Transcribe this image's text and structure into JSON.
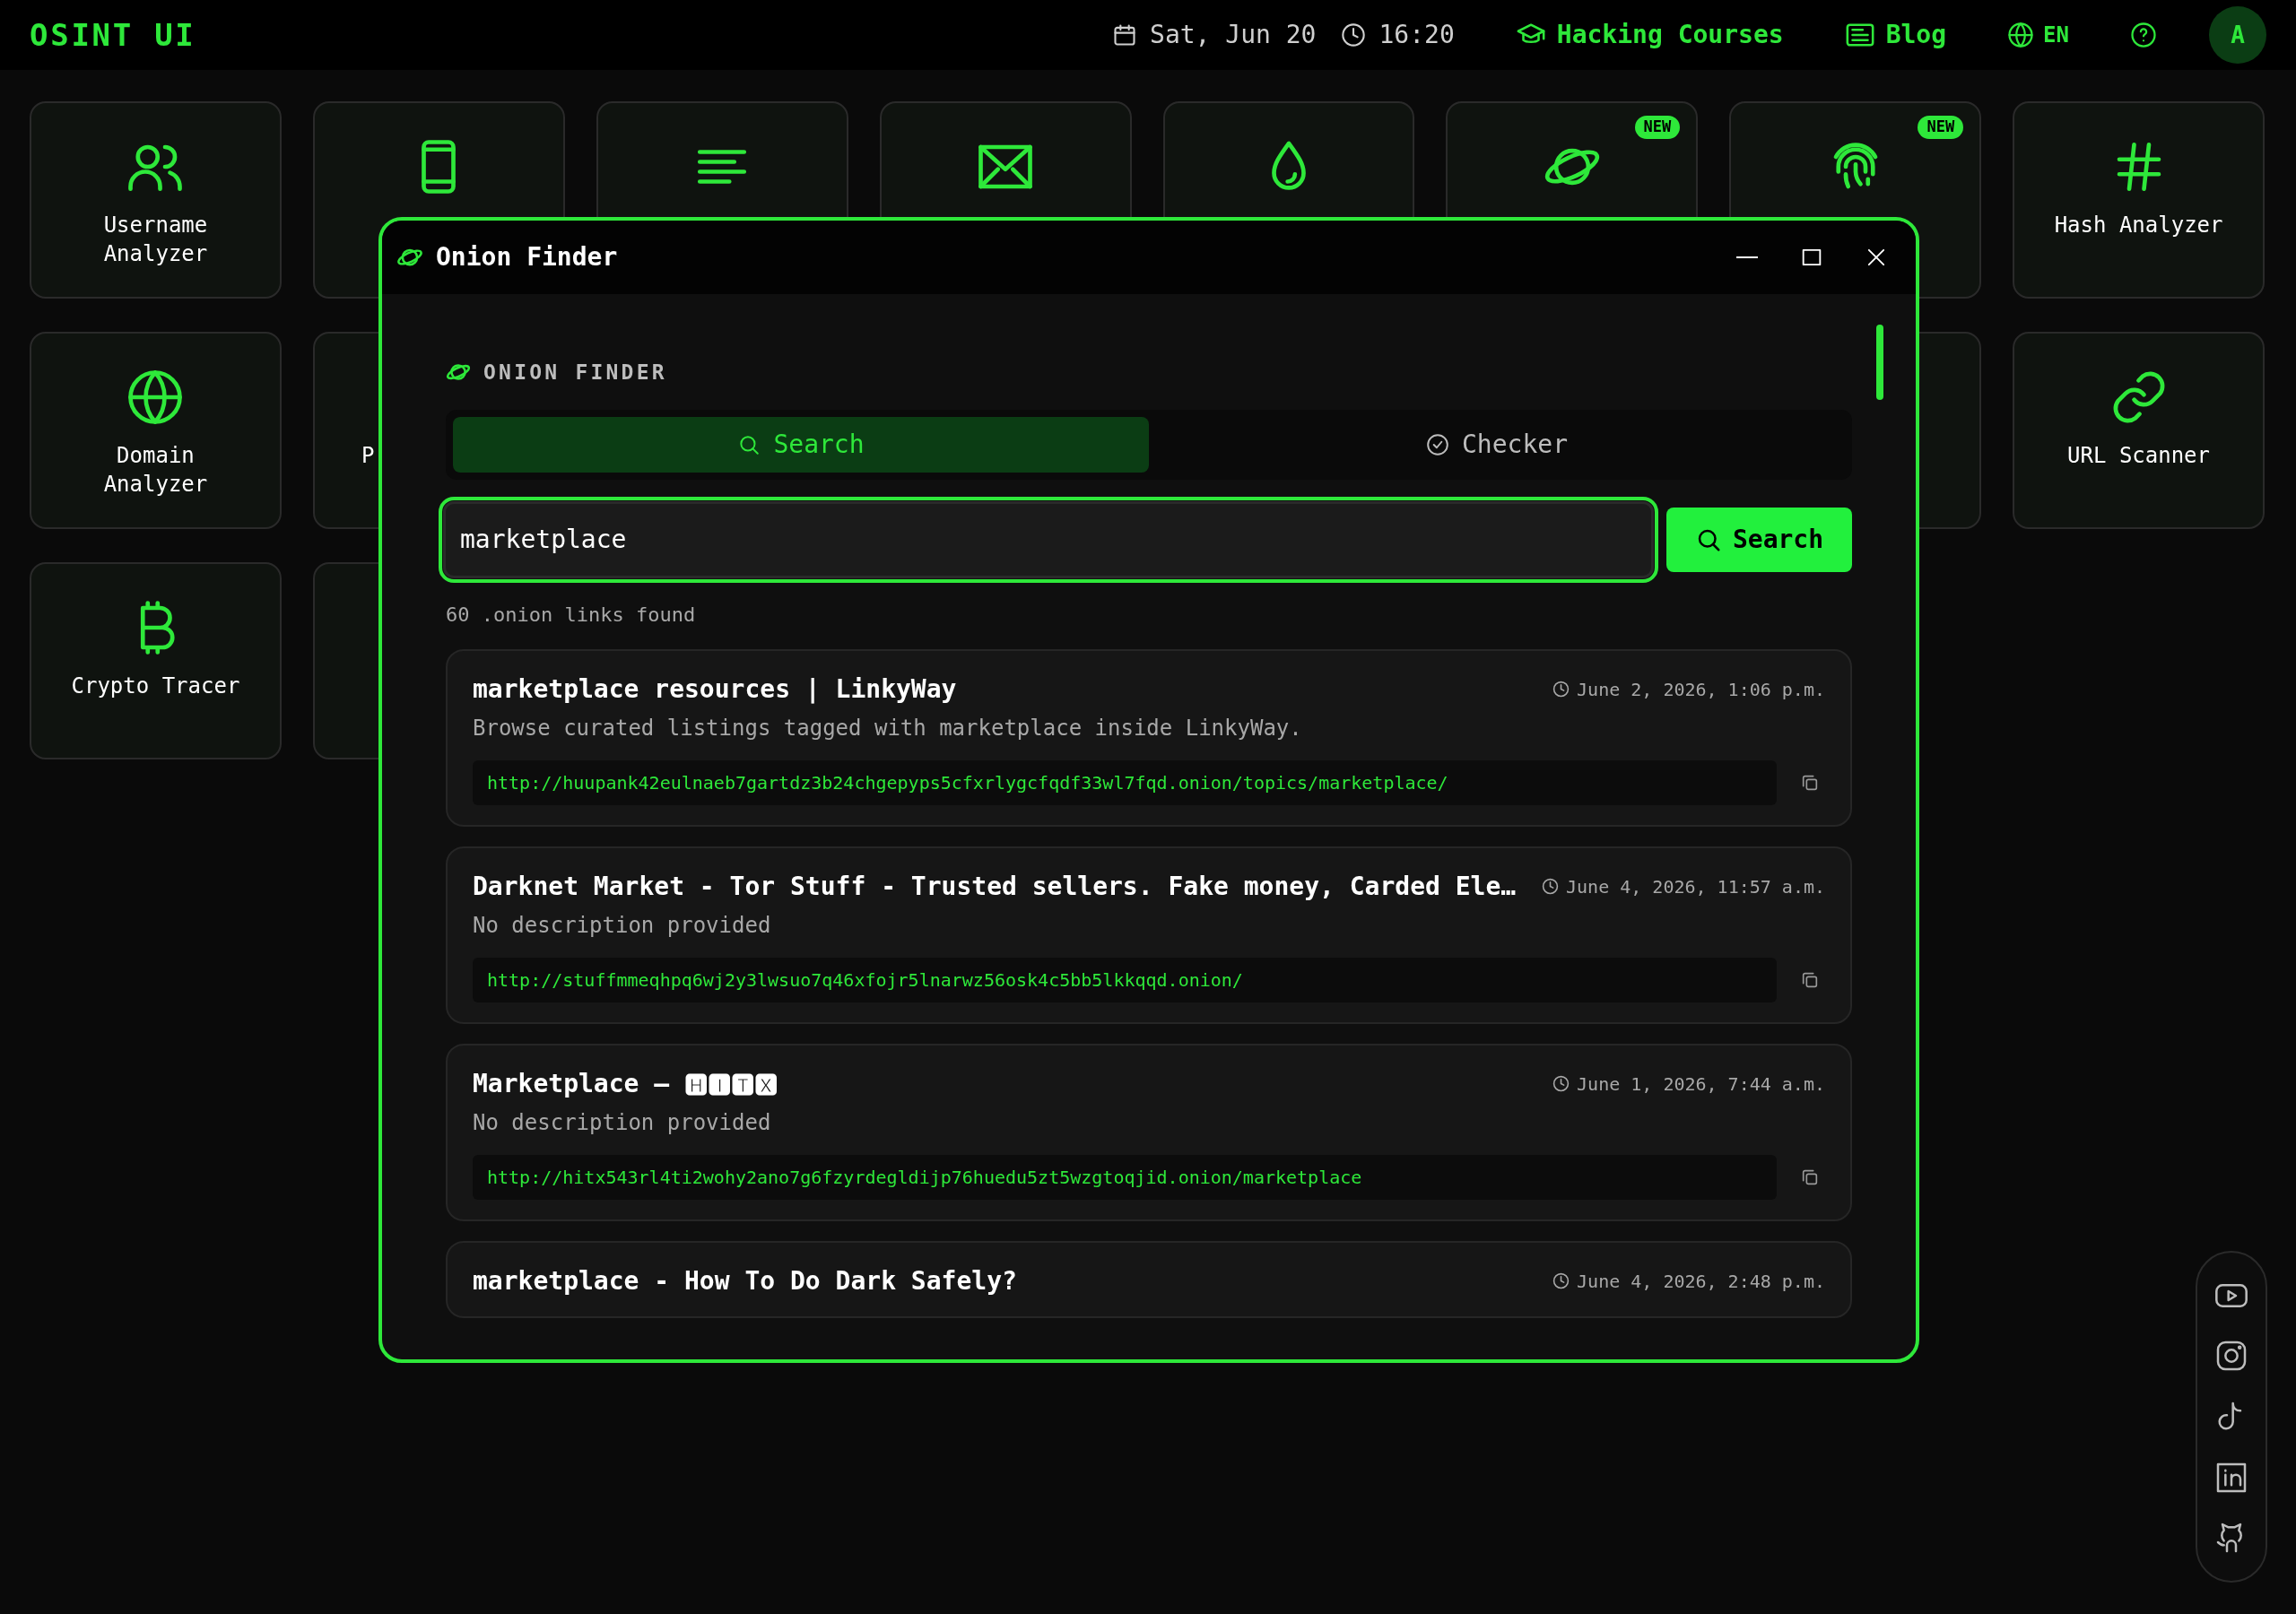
{
  "topbar": {
    "logo": "OSINT UI",
    "date": "Sat, Jun 20",
    "time": "16:20",
    "links": [
      {
        "label": "Hacking Courses"
      },
      {
        "label": "Blog"
      }
    ],
    "language": "EN",
    "avatar": "A"
  },
  "tool_rows": [
    [
      {
        "label": "Username Analyzer"
      },
      {},
      {},
      {},
      {},
      {
        "badge": "NEW"
      },
      {
        "badge": "NEW"
      },
      {
        "label": "Hash Analyzer"
      }
    ],
    [
      {
        "label": "Domain Analyzer"
      },
      {
        "label": "P"
      },
      {},
      {
        "label": "URL Scanner"
      }
    ],
    [
      {
        "label": "Crypto Tracer"
      },
      {}
    ]
  ],
  "window": {
    "title": "Onion Finder",
    "heading": "ONION FINDER",
    "tabs": [
      {
        "label": "Search",
        "selected": true
      },
      {
        "label": "Checker",
        "selected": false
      }
    ],
    "search": {
      "value": "marketplace",
      "button": "Search"
    },
    "result_count": "60 .onion links found",
    "results": [
      {
        "title": "marketplace resources | LinkyWay",
        "date": "June 2, 2026, 1:06 p.m.",
        "description": "Browse curated listings tagged with marketplace inside LinkyWay.",
        "url": "http://huupank42eulnaeb7gartdz3b24chgepyps5cfxrlygcfqdf33wl7fqd.onion/topics/marketplace/"
      },
      {
        "title": "Darknet Market - Tor Stuff - Trusted sellers. Fake money, Carded Ele…",
        "date": "June 4, 2026, 11:57 a.m.",
        "description": "No description provided",
        "url": "http://stuffmmeqhpq6wj2y3lwsuo7q46xfojr5lnarwz56osk4c5bb5lkkqqd.onion/"
      },
      {
        "title": "Marketplace — 🅷🅸🆃🆇",
        "date": "June 1, 2026, 7:44 a.m.",
        "description": "No description provided",
        "url": "http://hitx543rl4ti2wohy2ano7g6fzyrdegldijp76huedu5zt5wzgtoqjid.onion/marketplace"
      },
      {
        "title": "marketplace - How To Do Dark Safely?",
        "date": "June 4, 2026, 2:48 p.m."
      }
    ]
  }
}
